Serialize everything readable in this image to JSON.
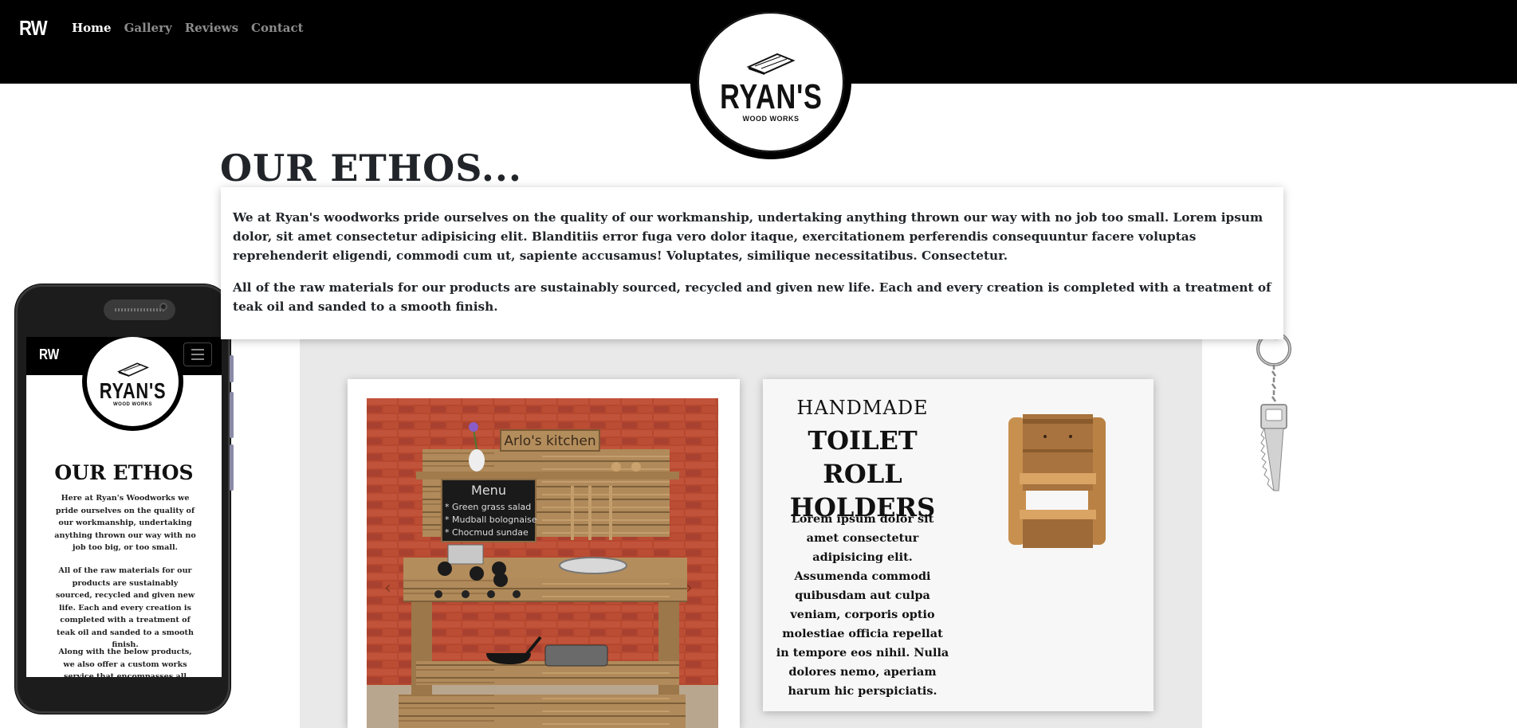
{
  "nav": {
    "brand": "RW",
    "links": [
      "Home",
      "Gallery",
      "Reviews",
      "Contact"
    ],
    "active": "Home"
  },
  "logo": {
    "name": "RYAN'S",
    "tagline": "WOOD WORKS"
  },
  "ethos": {
    "title": "OUR ETHOS...",
    "paragraph1": "We at Ryan's woodworks pride ourselves on the quality of our workmanship, undertaking anything thrown our way with no job too small. Lorem ipsum dolor, sit amet consectetur adipisicing elit. Blanditiis error fuga vero dolor itaque, exercitationem perferendis consequuntur facere voluptas reprehenderit eligendi, commodi cum ut, sapiente accusamus! Voluptates, similique necessitatibus. Consectetur.",
    "paragraph2": "All of the raw materials for our products are sustainably sourced, recycled and given new life. Each and every creation is completed with a treatment of teak oil and sanded to a smooth finish."
  },
  "kitchen_card": {
    "sign": "Arlo's kitchen",
    "menu_title": "Menu",
    "menu_items": [
      "* Green grass salad",
      "* Mudball bolognaise",
      "* Chocmud sundae"
    ],
    "prev_icon": "chevron-left-icon",
    "next_icon": "chevron-right-icon"
  },
  "toilet_card": {
    "kicker": "HANDMADE",
    "title": "TOILET ROLL HOLDERS",
    "description": "Lorem ipsum dolor sit amet consectetur adipisicing elit. Assumenda commodi quibusdam aut culpa veniam, corporis optio molestiae officia repellat in tempore eos nihil. Nulla dolores nemo, aperiam harum hic perspiciatis."
  },
  "mobile": {
    "brand": "RW",
    "menu_icon": "hamburger-icon",
    "logo_name": "RYAN'S",
    "logo_tagline": "WOOD WORKS",
    "title": "OUR ETHOS",
    "paragraph1": "Here at Ryan's Woodworks we pride ourselves on the quality of our workmanship, undertaking anything thrown our way with no job too big, or too small.",
    "paragraph2": "All of the raw materials for our products are sustainably sourced, recycled and given new life. Each and every creation is completed with a treatment of teak oil and sanded to a smooth finish.",
    "paragraph3": "Along with the below products, we also offer a custom works service that encompasses all aspects of woodwork"
  },
  "colors": {
    "navbar": "#000000",
    "grey_section": "#e9e9e9",
    "brick": "#b5482f",
    "wood": "#b08a5a"
  }
}
